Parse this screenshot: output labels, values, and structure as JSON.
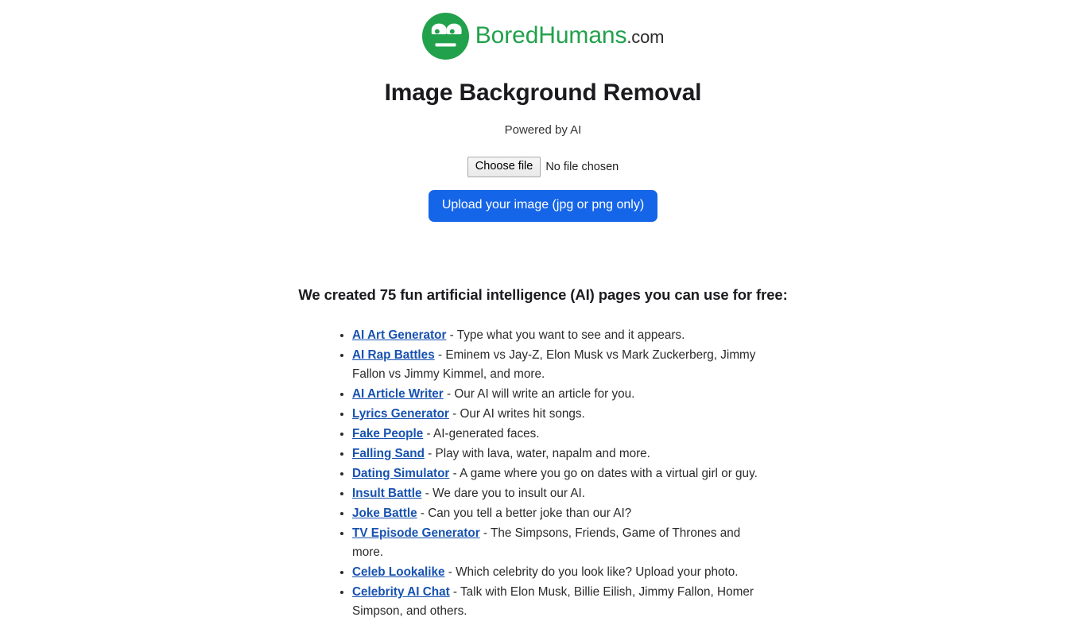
{
  "brand": {
    "logo_icon": "bored-face-icon",
    "name_part1": "Bored",
    "name_part2": "Humans",
    "tld": ".com",
    "green": "#21a14c",
    "tld_color": "#2b2b2b"
  },
  "header": {
    "title": "Image Background Removal",
    "subtitle": "Powered by AI"
  },
  "upload": {
    "choose_file_label": "Choose file",
    "file_status": "No file chosen",
    "submit_label": "Upload your image (jpg or png only)",
    "submit_color": "#1565e8"
  },
  "promo": {
    "heading": "We created 75 fun artificial intelligence (AI) pages you can use for free:",
    "link_color": "#1752b0",
    "separator": " - ",
    "items": [
      {
        "link": "AI Art Generator",
        "desc": "Type what you want to see and it appears."
      },
      {
        "link": "AI Rap Battles",
        "desc": "Eminem vs Jay-Z, Elon Musk vs Mark Zuckerberg, Jimmy Fallon vs Jimmy Kimmel, and more."
      },
      {
        "link": "AI Article Writer",
        "desc": "Our AI will write an article for you."
      },
      {
        "link": "Lyrics Generator",
        "desc": "Our AI writes hit songs."
      },
      {
        "link": "Fake People",
        "desc": "AI-generated faces."
      },
      {
        "link": "Falling Sand",
        "desc": "Play with lava, water, napalm and more."
      },
      {
        "link": "Dating Simulator",
        "desc": "A game where you go on dates with a virtual girl or guy."
      },
      {
        "link": "Insult Battle",
        "desc": "We dare you to insult our AI."
      },
      {
        "link": "Joke Battle",
        "desc": "Can you tell a better joke than our AI?"
      },
      {
        "link": "TV Episode Generator",
        "desc": "The Simpsons, Friends, Game of Thrones and more."
      },
      {
        "link": "Celeb Lookalike",
        "desc": "Which celebrity do you look like? Upload your photo."
      },
      {
        "link": "Celebrity AI Chat",
        "desc": "Talk with Elon Musk, Billie Eilish, Jimmy Fallon, Homer Simpson, and others."
      }
    ]
  }
}
